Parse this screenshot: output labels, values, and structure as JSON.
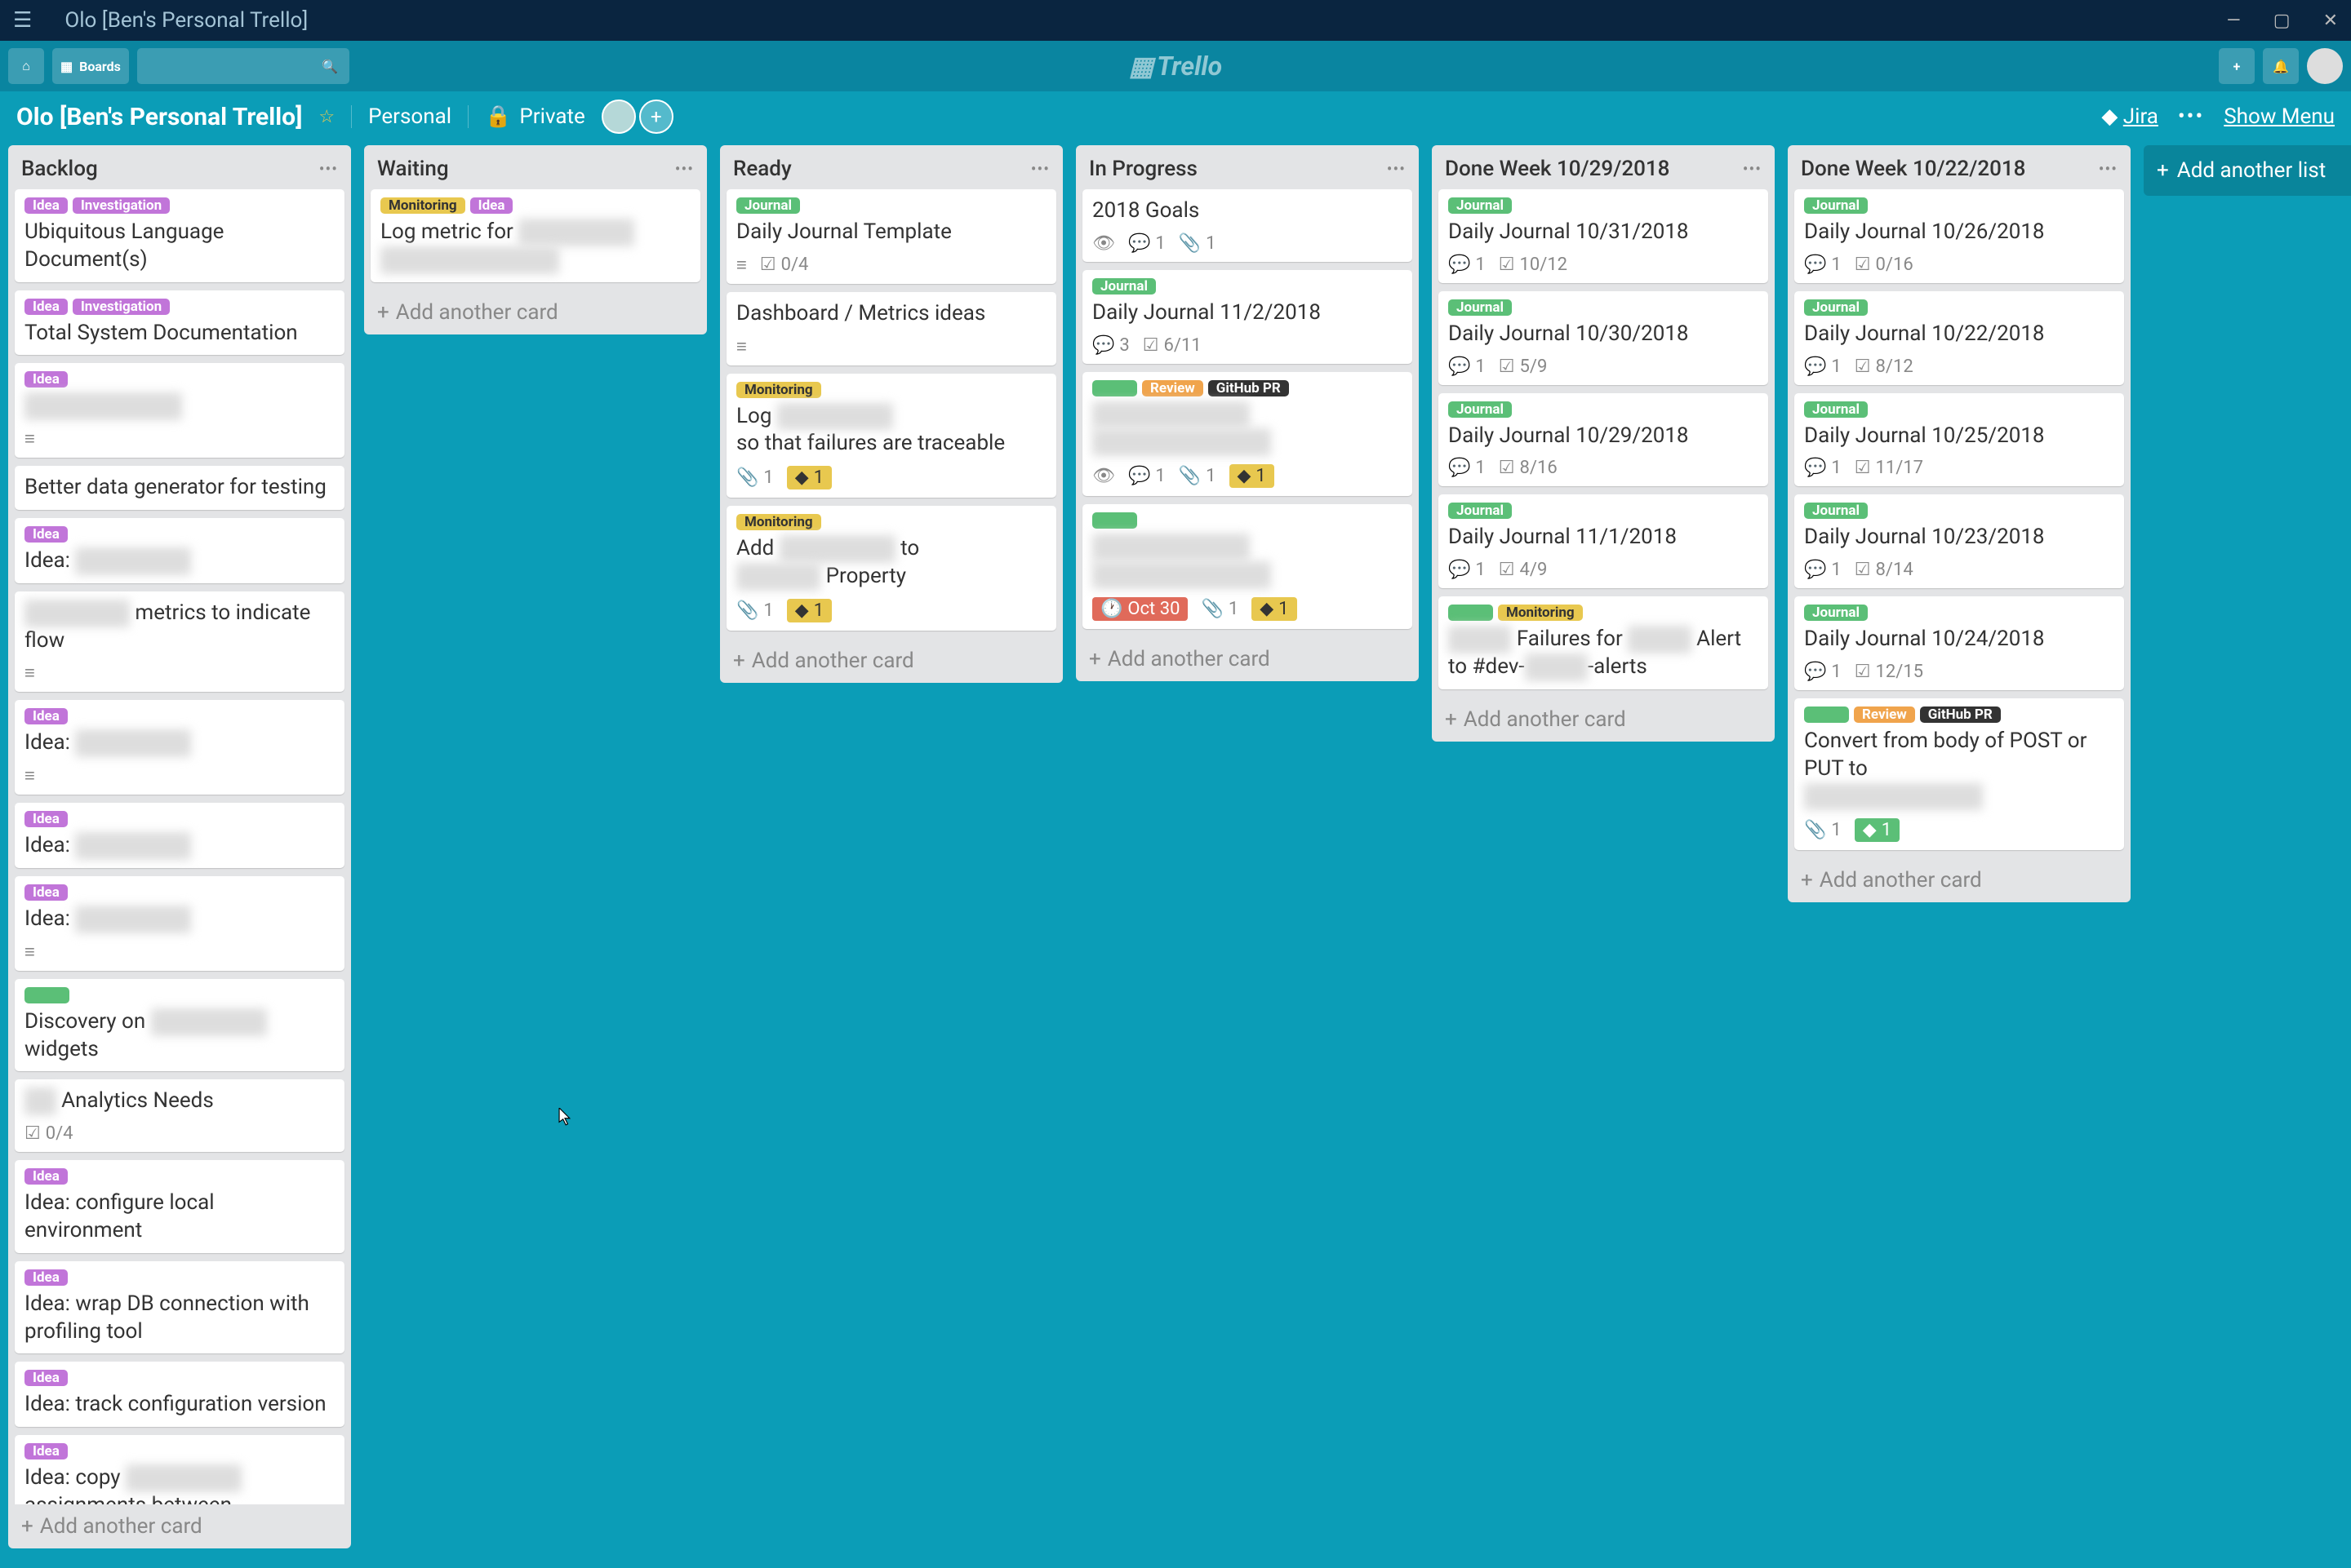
{
  "window": {
    "title": "Olo [Ben's Personal Trello]"
  },
  "topbar": {
    "boards": "Boards",
    "logo": "Trello"
  },
  "board": {
    "name": "Olo [Ben's Personal Trello]",
    "visibility_team": "Personal",
    "visibility_private": "Private",
    "jira": "Jira",
    "show_menu": "Show Menu"
  },
  "add_list": "Add another list",
  "add_card": "Add another card",
  "lists": [
    {
      "name": "Backlog",
      "cards": [
        {
          "labels": [
            {
              "t": "Idea",
              "c": "idea"
            },
            {
              "t": "Investigation",
              "c": "investigation"
            }
          ],
          "title": "Ubiquitous Language Document(s)"
        },
        {
          "labels": [
            {
              "t": "Idea",
              "c": "idea"
            },
            {
              "t": "Investigation",
              "c": "investigation"
            }
          ],
          "title": "Total System Documentation"
        },
        {
          "labels": [
            {
              "t": "Idea",
              "c": "idea"
            }
          ],
          "title_blur": true,
          "badges": [
            {
              "type": "desc"
            }
          ]
        },
        {
          "title": "Better data generator for testing"
        },
        {
          "labels": [
            {
              "t": "Idea",
              "c": "idea"
            }
          ],
          "title": "Idea: ",
          "title_blur_suffix": true
        },
        {
          "title_prefix_blur": true,
          "title": " metrics to indicate flow",
          "badges": [
            {
              "type": "desc"
            }
          ]
        },
        {
          "labels": [
            {
              "t": "Idea",
              "c": "idea"
            }
          ],
          "title": "Idea: ",
          "title_blur_suffix": true,
          "badges": [
            {
              "type": "desc"
            }
          ]
        },
        {
          "labels": [
            {
              "t": "Idea",
              "c": "idea"
            }
          ],
          "title": "Idea: ",
          "title_blur_suffix": true
        },
        {
          "labels": [
            {
              "t": "Idea",
              "c": "idea"
            }
          ],
          "title": "Idea: ",
          "title_blur_suffix": true,
          "badges": [
            {
              "type": "desc"
            }
          ]
        },
        {
          "labels": [
            {
              "t": "",
              "c": "blank-green"
            }
          ],
          "title": "Discovery on ",
          "title_blur_suffix": true,
          "title2": "widgets"
        },
        {
          "title_prefix_blur_short": true,
          "title": " Analytics Needs",
          "badges": [
            {
              "type": "check",
              "val": "0/4"
            }
          ]
        },
        {
          "labels": [
            {
              "t": "Idea",
              "c": "idea"
            }
          ],
          "title": "Idea: configure local environment"
        },
        {
          "labels": [
            {
              "t": "Idea",
              "c": "idea"
            }
          ],
          "title": "Idea: wrap DB connection with profiling tool"
        },
        {
          "labels": [
            {
              "t": "Idea",
              "c": "idea"
            }
          ],
          "title": "Idea: track configuration version"
        },
        {
          "labels": [
            {
              "t": "Idea",
              "c": "idea"
            }
          ],
          "title": "Idea: copy ",
          "title_blur_suffix": true,
          "title2": "assignments between environments"
        }
      ]
    },
    {
      "name": "Waiting",
      "cards": [
        {
          "labels": [
            {
              "t": "Monitoring",
              "c": "monitoring"
            },
            {
              "t": "Idea",
              "c": "idea"
            }
          ],
          "title": "Log metric for ",
          "title_blur_suffix": true,
          "title_blur_line2": true
        }
      ]
    },
    {
      "name": "Ready",
      "cards": [
        {
          "labels": [
            {
              "t": "Journal",
              "c": "journal"
            }
          ],
          "title": "Daily Journal Template",
          "badges": [
            {
              "type": "desc"
            },
            {
              "type": "check",
              "val": "0/4"
            }
          ]
        },
        {
          "title": "Dashboard / Metrics ideas",
          "badges": [
            {
              "type": "desc"
            }
          ]
        },
        {
          "labels": [
            {
              "t": "Monitoring",
              "c": "monitoring"
            }
          ],
          "title": "Log ",
          "title_blur_suffix": true,
          "title2": "so that failures are traceable",
          "badges": [
            {
              "type": "attach",
              "val": "1"
            },
            {
              "type": "power",
              "val": "1"
            }
          ]
        },
        {
          "labels": [
            {
              "t": "Monitoring",
              "c": "monitoring"
            }
          ],
          "title": "Add ",
          "title_blur_suffix": true,
          "title_mid": " to ",
          "title_blur_line2_short": true,
          "title2_suffix": " Property",
          "badges": [
            {
              "type": "attach",
              "val": "1"
            },
            {
              "type": "power",
              "val": "1"
            }
          ]
        }
      ]
    },
    {
      "name": "In Progress",
      "cards": [
        {
          "title": "2018 Goals",
          "badges": [
            {
              "type": "eye"
            },
            {
              "type": "comment",
              "val": "1"
            },
            {
              "type": "attach",
              "val": "1"
            }
          ]
        },
        {
          "labels": [
            {
              "t": "Journal",
              "c": "journal"
            }
          ],
          "title": "Daily Journal 11/2/2018",
          "badges": [
            {
              "type": "comment",
              "val": "3"
            },
            {
              "type": "check",
              "val": "6/11"
            }
          ]
        },
        {
          "labels": [
            {
              "t": "",
              "c": "blank-green"
            },
            {
              "t": "Review",
              "c": "review"
            },
            {
              "t": "GitHub PR",
              "c": "githubpr"
            }
          ],
          "title_blur": true,
          "title_blur_line2": true,
          "badges": [
            {
              "type": "eye"
            },
            {
              "type": "comment",
              "val": "1"
            },
            {
              "type": "attach",
              "val": "1"
            },
            {
              "type": "power",
              "val": "1"
            }
          ]
        },
        {
          "labels": [
            {
              "t": "",
              "c": "blank-green"
            }
          ],
          "title_blur": true,
          "title_blur_line2": true,
          "badges": [
            {
              "type": "due",
              "val": "Oct 30"
            },
            {
              "type": "attach",
              "val": "1"
            },
            {
              "type": "power",
              "val": "1"
            }
          ]
        }
      ]
    },
    {
      "name": "Done Week 10/29/2018",
      "cards": [
        {
          "labels": [
            {
              "t": "Journal",
              "c": "journal"
            }
          ],
          "title": "Daily Journal 10/31/2018",
          "badges": [
            {
              "type": "comment",
              "val": "1"
            },
            {
              "type": "check",
              "val": "10/12"
            }
          ]
        },
        {
          "labels": [
            {
              "t": "Journal",
              "c": "journal"
            }
          ],
          "title": "Daily Journal 10/30/2018",
          "badges": [
            {
              "type": "comment",
              "val": "1"
            },
            {
              "type": "check",
              "val": "5/9"
            }
          ]
        },
        {
          "labels": [
            {
              "t": "Journal",
              "c": "journal"
            }
          ],
          "title": "Daily Journal 10/29/2018",
          "badges": [
            {
              "type": "comment",
              "val": "1"
            },
            {
              "type": "check",
              "val": "8/16"
            }
          ]
        },
        {
          "labels": [
            {
              "t": "Journal",
              "c": "journal"
            }
          ],
          "title": "Daily Journal 11/1/2018",
          "badges": [
            {
              "type": "comment",
              "val": "1"
            },
            {
              "type": "check",
              "val": "4/9"
            }
          ]
        },
        {
          "labels": [
            {
              "t": "",
              "c": "blank-green"
            },
            {
              "t": "Monitoring",
              "c": "monitoring"
            }
          ],
          "title_complex": [
            " Failures for ",
            " Alert to #dev-",
            "-alerts"
          ],
          "title_blurs": [
            true,
            true,
            true
          ]
        }
      ]
    },
    {
      "name": "Done Week 10/22/2018",
      "cards": [
        {
          "labels": [
            {
              "t": "Journal",
              "c": "journal"
            }
          ],
          "title": "Daily Journal 10/26/2018",
          "badges": [
            {
              "type": "comment",
              "val": "1"
            },
            {
              "type": "check",
              "val": "0/16"
            }
          ]
        },
        {
          "labels": [
            {
              "t": "Journal",
              "c": "journal"
            }
          ],
          "title": "Daily Journal 10/22/2018",
          "badges": [
            {
              "type": "comment",
              "val": "1"
            },
            {
              "type": "check",
              "val": "8/12"
            }
          ]
        },
        {
          "labels": [
            {
              "t": "Journal",
              "c": "journal"
            }
          ],
          "title": "Daily Journal 10/25/2018",
          "badges": [
            {
              "type": "comment",
              "val": "1"
            },
            {
              "type": "check",
              "val": "11/17"
            }
          ]
        },
        {
          "labels": [
            {
              "t": "Journal",
              "c": "journal"
            }
          ],
          "title": "Daily Journal 10/23/2018",
          "badges": [
            {
              "type": "comment",
              "val": "1"
            },
            {
              "type": "check",
              "val": "8/14"
            }
          ]
        },
        {
          "labels": [
            {
              "t": "Journal",
              "c": "journal"
            }
          ],
          "title": "Daily Journal 10/24/2018",
          "badges": [
            {
              "type": "comment",
              "val": "1"
            },
            {
              "type": "check",
              "val": "12/15"
            }
          ]
        },
        {
          "labels": [
            {
              "t": "",
              "c": "blank-green"
            },
            {
              "t": "Review",
              "c": "review"
            },
            {
              "t": "GitHub PR",
              "c": "githubpr"
            }
          ],
          "title": "Convert from body of POST or PUT to ",
          "title_blur_line2": true,
          "badges": [
            {
              "type": "attach",
              "val": "1"
            },
            {
              "type": "power-green",
              "val": "1"
            }
          ]
        }
      ]
    }
  ]
}
